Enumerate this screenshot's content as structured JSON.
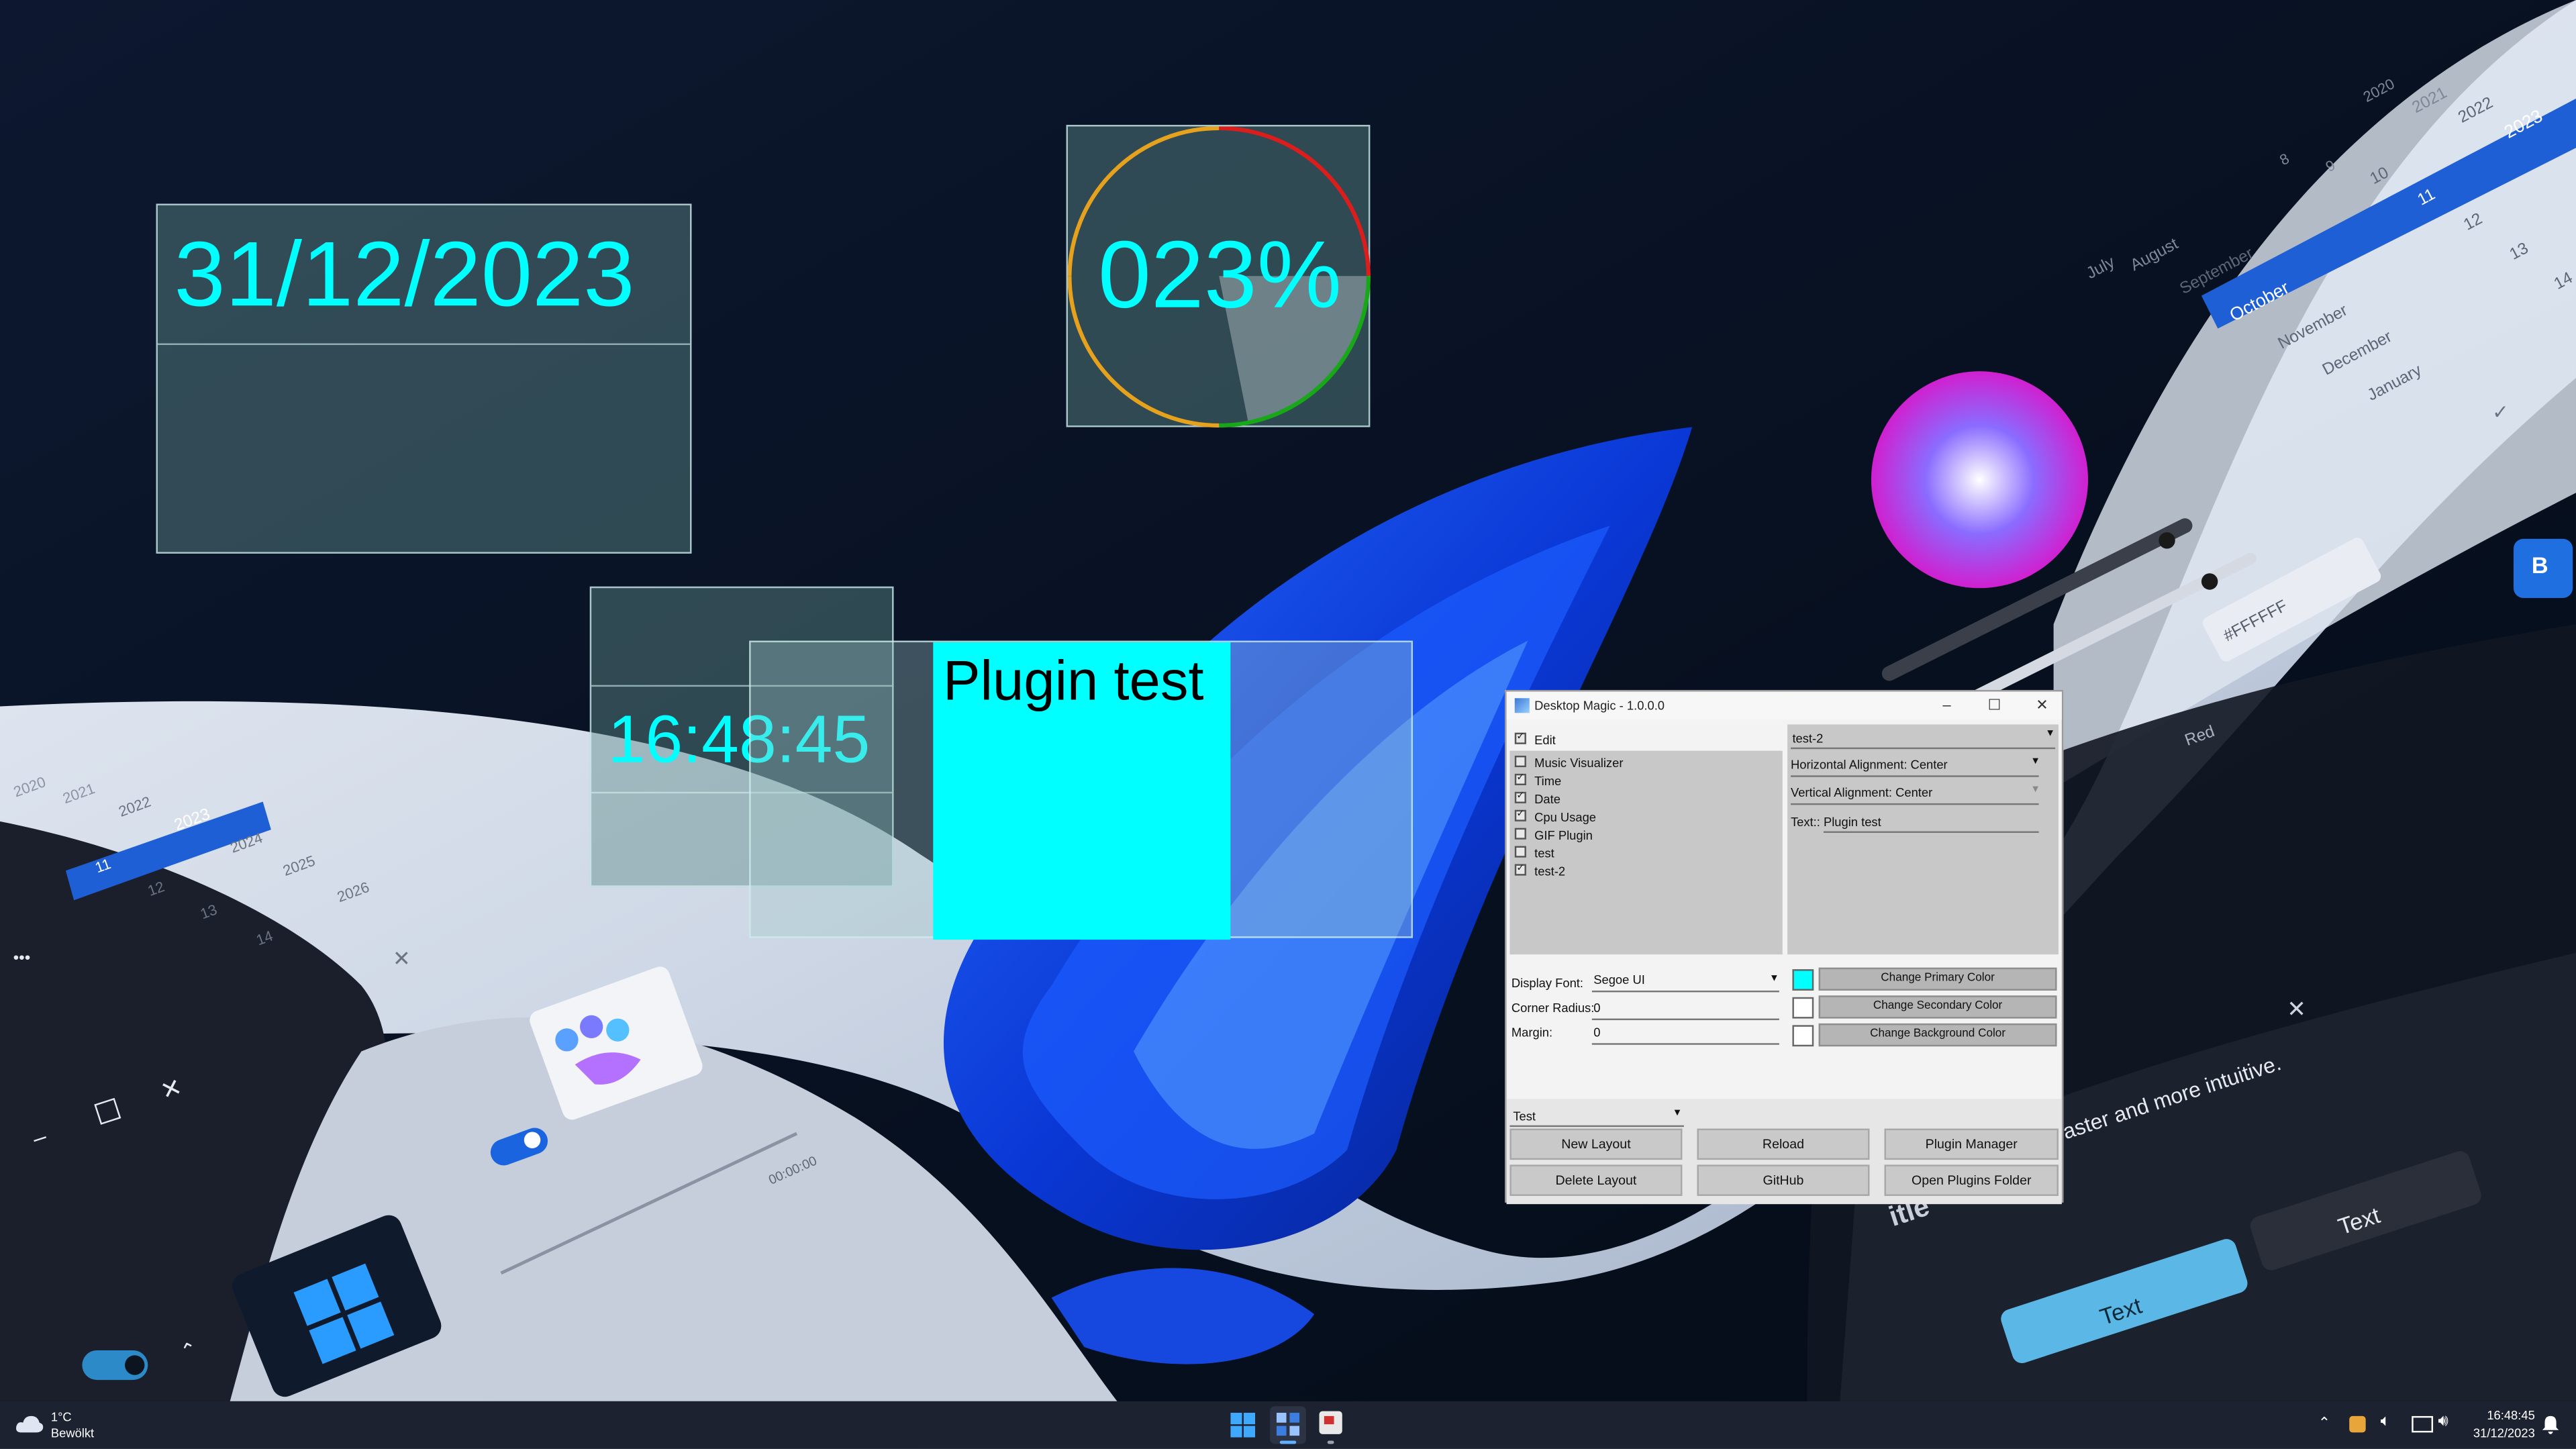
{
  "wallpaper": {
    "calendar_right": {
      "months": [
        "July",
        "August",
        "September",
        "October",
        "November",
        "December",
        "January"
      ],
      "days": [
        "8",
        "9",
        "10",
        "11",
        "12",
        "13",
        "14"
      ],
      "years": [
        "2020",
        "2021",
        "2022",
        "2023"
      ]
    },
    "calendar_left": {
      "years": [
        "2020",
        "2021",
        "2022",
        "2023",
        "2024",
        "2025",
        "2026"
      ],
      "days": [
        "11",
        "12",
        "13",
        "14"
      ]
    },
    "hex_value": "#FFFFFF",
    "red_label": "Red",
    "b_badge": "B",
    "media_time": "00:00:00",
    "title_fragment": "itle",
    "tooltip_text": "Windows 11 is faster and more intuitive.",
    "text_button_primary": "Text",
    "text_button_secondary": "Text"
  },
  "widgets": {
    "date": "31/12/2023",
    "cpu": {
      "text": "023%",
      "value": 23
    },
    "time": "16:48:45",
    "plugin": "Plugin test"
  },
  "colors": {
    "widget_text": "#00ffff",
    "primary": "#00ffff",
    "secondary": "#ffffff",
    "background": "#ffffff"
  },
  "app": {
    "title": "Desktop Magic - 1.0.0.0",
    "edit_label": "Edit",
    "plugins": [
      {
        "name": "Music Visualizer",
        "checked": false
      },
      {
        "name": "Time",
        "checked": true
      },
      {
        "name": "Date",
        "checked": true
      },
      {
        "name": "Cpu Usage",
        "checked": true
      },
      {
        "name": "GIF Plugin",
        "checked": false
      },
      {
        "name": "test",
        "checked": false
      },
      {
        "name": "test-2",
        "checked": true
      }
    ],
    "selected_plugin": "test-2",
    "props": {
      "h_align": "Horizontal Alignment: Center",
      "v_align": "Vertical Alignment: Center",
      "text": "Text:: Plugin test"
    },
    "display_font_label": "Display Font:",
    "display_font_value": "Segoe UI",
    "corner_radius_label": "Corner Radius:",
    "corner_radius_value": "0",
    "margin_label": "Margin:",
    "margin_value": "0",
    "change_primary": "Change Primary Color",
    "change_secondary": "Change Secondary Color",
    "change_background": "Change Background Color",
    "layout_select": "Test",
    "buttons": {
      "new_layout": "New Layout",
      "reload": "Reload",
      "plugin_manager": "Plugin Manager",
      "delete_layout": "Delete Layout",
      "github": "GitHub",
      "open_plugins_folder": "Open Plugins Folder"
    }
  },
  "taskbar": {
    "temp": "1°C",
    "weather": "Bewölkt",
    "clock_time": "16:48:45",
    "clock_date": "31/12/2023"
  }
}
